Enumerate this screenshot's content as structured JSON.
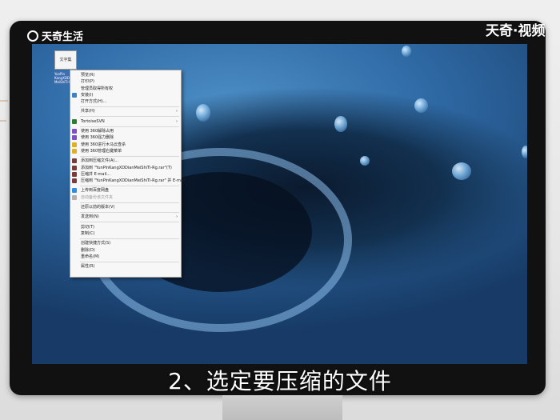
{
  "watermark": {
    "left_logo_text": "天奇生活",
    "right_logo_text": "天奇·视频"
  },
  "subtitle": "2、选定要压缩的文件",
  "desktop_icon": {
    "thumb_text": "文字集",
    "caption": "YunPin KangXDDian MeiShiTi-Rg"
  },
  "context_menu": {
    "items": [
      {
        "label": "预览(R)",
        "icon": "",
        "type": "item"
      },
      {
        "label": "打印(P)",
        "icon": "",
        "type": "item"
      },
      {
        "label": "管理员取得所有权",
        "icon": "",
        "type": "item"
      },
      {
        "label": "安装(I)",
        "icon": "shield-icon",
        "type": "item"
      },
      {
        "label": "打开方式(H)...",
        "icon": "",
        "type": "item"
      },
      {
        "type": "separator"
      },
      {
        "label": "共享(H)",
        "icon": "",
        "type": "submenu"
      },
      {
        "type": "separator"
      },
      {
        "label": "TortoiseSVN",
        "icon": "tortoise-icon",
        "type": "submenu"
      },
      {
        "type": "separator"
      },
      {
        "label": "使用 360解除占用",
        "icon": "360-icon",
        "type": "item"
      },
      {
        "label": "使用 360强力删除",
        "icon": "360-icon",
        "type": "item"
      },
      {
        "label": "使用 360进行木马云查杀",
        "icon": "360-yellow-icon",
        "type": "item"
      },
      {
        "label": "使用 360管理右键菜单",
        "icon": "360-yellow-icon",
        "type": "item"
      },
      {
        "type": "separator"
      },
      {
        "label": "添加到压缩文件(A)...",
        "icon": "archive-icon",
        "type": "item"
      },
      {
        "label": "添加到 \"YunPinKangXDDianMeiShiTi-Rg.rar\"(T)",
        "icon": "archive-icon",
        "type": "item"
      },
      {
        "label": "压缩并 E-mail...",
        "icon": "archive-icon",
        "type": "item"
      },
      {
        "label": "压缩到 \"YunPinKangXDDianMeiShiTi-Rg.rar\" 并 E-mail",
        "icon": "archive-icon",
        "type": "item"
      },
      {
        "type": "separator"
      },
      {
        "label": "上传到百度网盘",
        "icon": "cloud-icon",
        "type": "item"
      },
      {
        "label": "自动备份该文件夹",
        "icon": "cloud-gray-icon",
        "type": "disabled"
      },
      {
        "type": "separator"
      },
      {
        "label": "还原以前的版本(V)",
        "icon": "",
        "type": "item"
      },
      {
        "type": "separator"
      },
      {
        "label": "发送到(N)",
        "icon": "",
        "type": "submenu"
      },
      {
        "type": "separator"
      },
      {
        "label": "剪切(T)",
        "icon": "",
        "type": "item"
      },
      {
        "label": "复制(C)",
        "icon": "",
        "type": "item"
      },
      {
        "type": "separator"
      },
      {
        "label": "创建快捷方式(S)",
        "icon": "",
        "type": "item"
      },
      {
        "label": "删除(D)",
        "icon": "",
        "type": "item"
      },
      {
        "label": "重命名(M)",
        "icon": "",
        "type": "item"
      },
      {
        "type": "separator"
      },
      {
        "label": "属性(R)",
        "icon": "",
        "type": "item"
      }
    ],
    "arrow_glyph": "›"
  },
  "icon_colors": {
    "shield-icon": "#3b82c4",
    "tortoise-icon": "#2e7d32",
    "360-icon": "#7d4fc0",
    "360-yellow-icon": "#e0b020",
    "archive-icon": "#7a3b3b",
    "cloud-icon": "#2d8fe0",
    "cloud-gray-icon": "#b0b0b0"
  }
}
